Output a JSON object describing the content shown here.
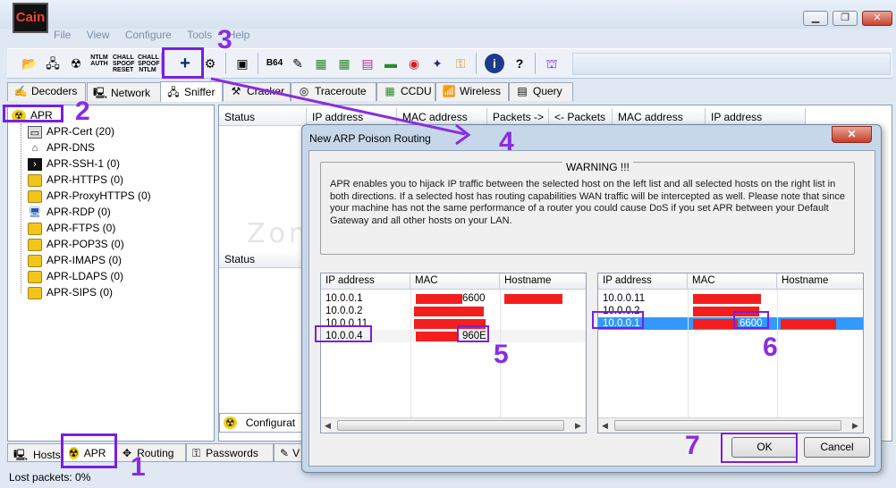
{
  "app": {
    "icon_text": "Cain"
  },
  "menu": [
    "File",
    "View",
    "Configure",
    "Tools",
    "Help"
  ],
  "toolbar": {
    "add_label": "+",
    "b64_label": "B64"
  },
  "tabs": [
    {
      "label": "Decoders",
      "icon": "decoders-icon"
    },
    {
      "label": "Network",
      "icon": "network-icon"
    },
    {
      "label": "Sniffer",
      "icon": "sniffer-icon"
    },
    {
      "label": "Cracker",
      "icon": "cracker-icon"
    },
    {
      "label": "Traceroute",
      "icon": "traceroute-icon"
    },
    {
      "label": "CCDU",
      "icon": "ccdu-icon"
    },
    {
      "label": "Wireless",
      "icon": "wireless-icon"
    },
    {
      "label": "Query",
      "icon": "query-icon"
    }
  ],
  "tree": {
    "root": "APR",
    "items": [
      "APR-Cert (20)",
      "APR-DNS",
      "APR-SSH-1 (0)",
      "APR-HTTPS (0)",
      "APR-ProxyHTTPS (0)",
      "APR-RDP (0)",
      "APR-FTPS (0)",
      "APR-POP3S (0)",
      "APR-IMAPS (0)",
      "APR-LDAPS (0)",
      "APR-SIPS (0)"
    ]
  },
  "main_table": {
    "headers": [
      "Status",
      "IP address",
      "MAC address",
      "Packets ->",
      "<- Packets",
      "MAC address",
      "IP address"
    ],
    "lower_header": "Status",
    "config_tab": "Configurat"
  },
  "bottom_tabs": [
    "Hosts",
    "APR",
    "Routing",
    "Passwords",
    "V"
  ],
  "status": {
    "lost_packets": "Lost packets:  0%"
  },
  "dialog": {
    "title": "New ARP Poison Routing",
    "close": "✕",
    "warning_title": "WARNING !!!",
    "warning_text": "APR enables you to hijack IP traffic between the selected host on the left list and all selected hosts on the right list in both directions. If a selected host has routing capabilities WAN traffic will be intercepted as well. Please note that since your machine has not the same performance of a router you could cause DoS if you set APR between your Default Gateway and all other hosts on your LAN.",
    "left_list": {
      "headers": [
        "IP address",
        "MAC",
        "Hostname"
      ],
      "rows": [
        {
          "ip": "10.0.0.1",
          "mac": "6600"
        },
        {
          "ip": "10.0.0.2",
          "mac": ""
        },
        {
          "ip": "10.0.0.11",
          "mac": ""
        },
        {
          "ip": "10.0.0.4",
          "mac": "960E"
        }
      ]
    },
    "right_list": {
      "headers": [
        "IP address",
        "MAC",
        "Hostname"
      ],
      "rows": [
        {
          "ip": "10.0.0.11",
          "mac": ""
        },
        {
          "ip": "10.0.0.2",
          "mac": ""
        },
        {
          "ip": "10.0.0.1",
          "mac": "6600"
        }
      ]
    },
    "ok": "OK",
    "cancel": "Cancel"
  },
  "watermark": "Zona System",
  "annotations": [
    "1",
    "2",
    "3",
    "4",
    "5",
    "6",
    "7"
  ],
  "colors": {
    "annotation": "#7a1fe0",
    "redaction": "#f41e1e",
    "selection": "#3399ff"
  }
}
